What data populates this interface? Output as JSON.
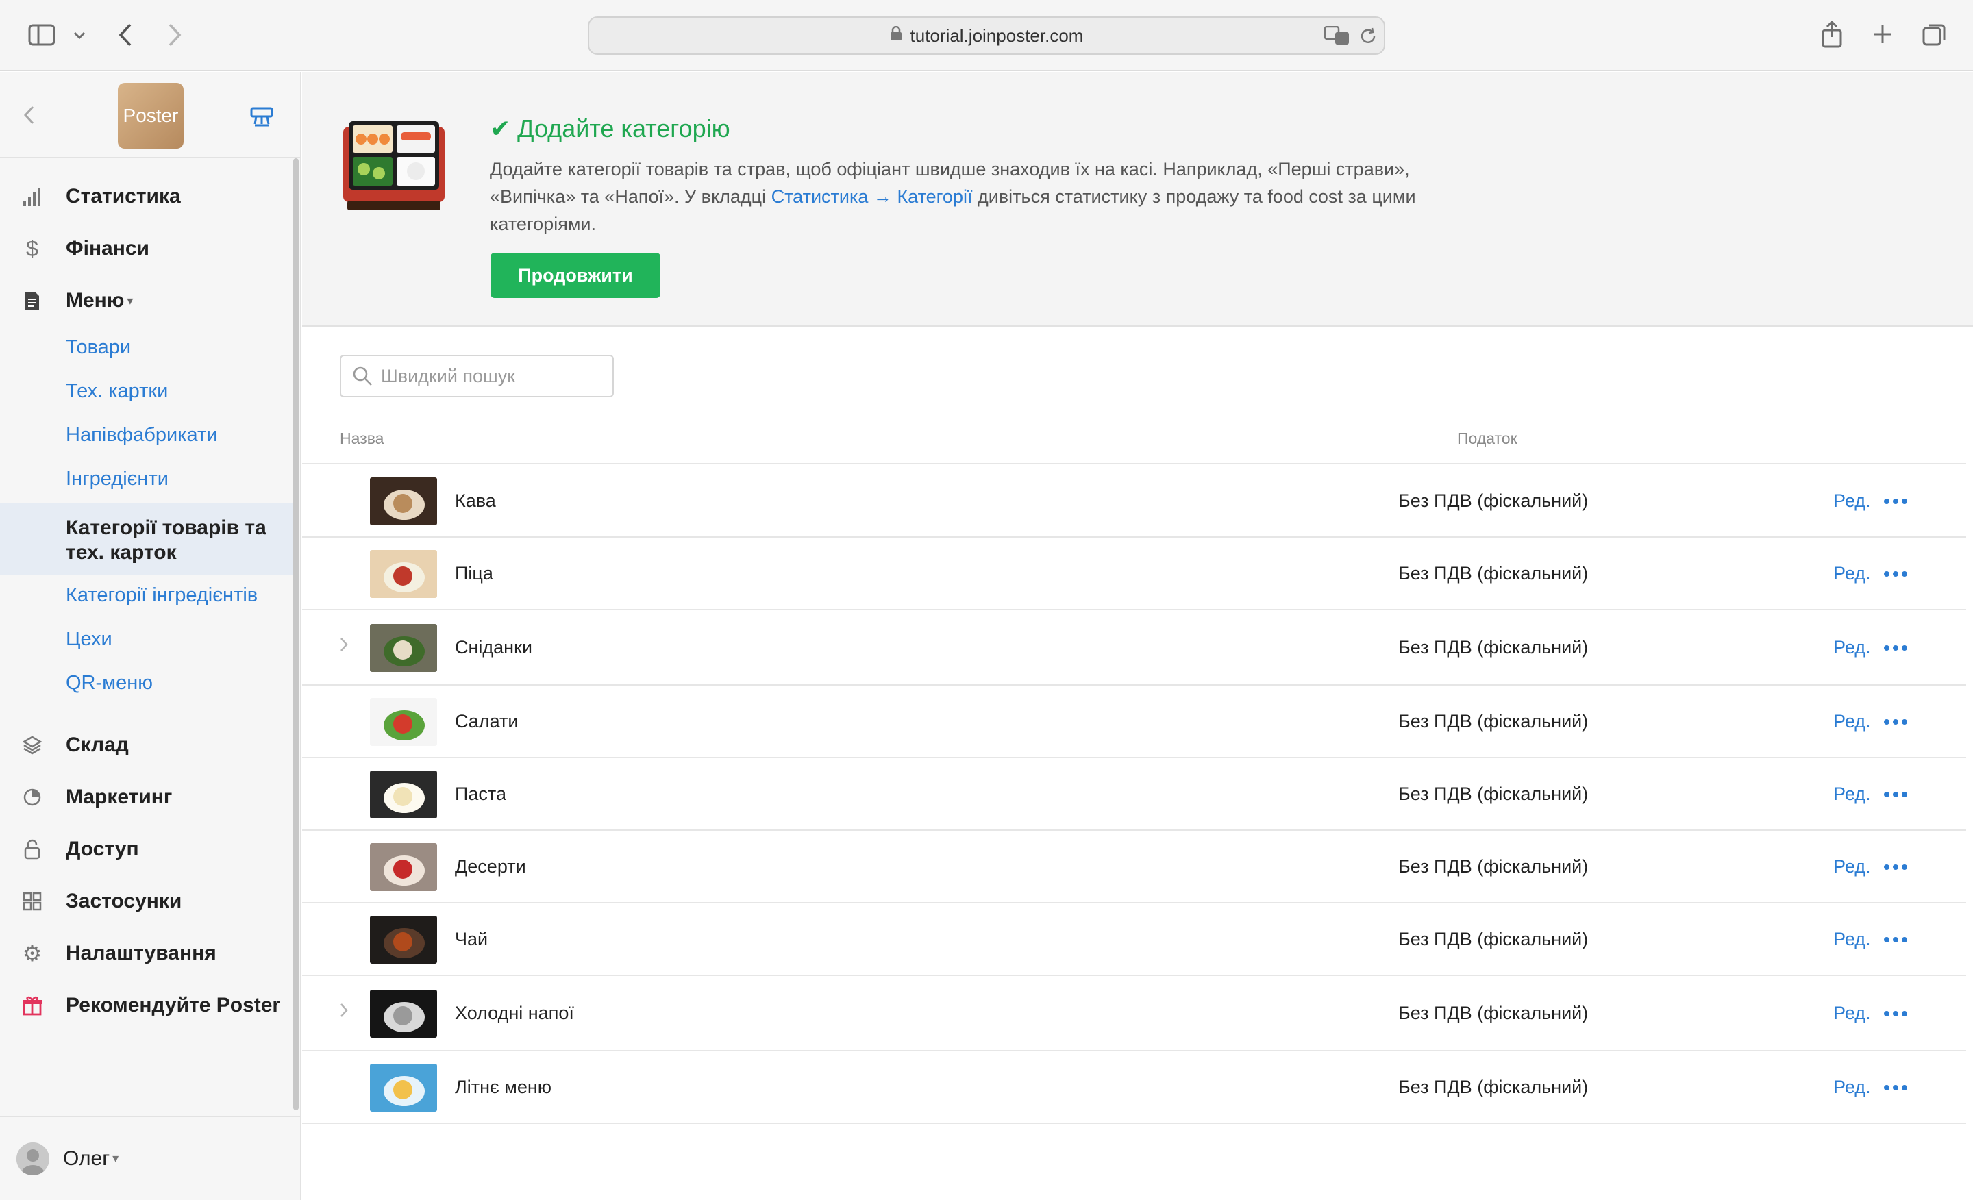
{
  "browser": {
    "url": "tutorial.joinposter.com"
  },
  "sidebar": {
    "logo_text": "Poster",
    "nav": [
      {
        "label": "Статистика",
        "icon": "bar-chart-icon"
      },
      {
        "label": "Фінанси",
        "icon": "dollar-icon"
      },
      {
        "label": "Меню",
        "icon": "document-icon",
        "expanded": true
      }
    ],
    "menu_caret": "▾",
    "sub_items": [
      {
        "label": "Товари"
      },
      {
        "label": "Тех. картки"
      },
      {
        "label": "Напівфабрикати"
      },
      {
        "label": "Інгредієнти"
      }
    ],
    "active_sub": "Категорії товарів та тех. карток",
    "sub_items_after": [
      {
        "label": "Категорії інгредієнтів"
      },
      {
        "label": "Цехи"
      },
      {
        "label": "QR-меню"
      }
    ],
    "nav_bottom": [
      {
        "label": "Склад",
        "icon": "layers-icon"
      },
      {
        "label": "Маркетинг",
        "icon": "pie-icon"
      },
      {
        "label": "Доступ",
        "icon": "lock-icon"
      },
      {
        "label": "Застосунки",
        "icon": "apps-grid-icon"
      },
      {
        "label": "Налаштування",
        "icon": "gear-icon"
      },
      {
        "label": "Рекомендуйте Poster",
        "icon": "gift-icon"
      }
    ],
    "user": "Олег",
    "user_caret": "▾"
  },
  "banner": {
    "title": "✔ Додайте категорію",
    "text_part1": "Додайте категорії товарів та страв, щоб офіціант швидше знаходив їх на касі. Наприклад, «Перші страви», «Випічка» та «Напої». У вкладці ",
    "link1": "Статистика",
    "arrow": " → ",
    "link2": "Категорії",
    "text_part2": " дивіться статистику з продажу та food cost за цими категоріями.",
    "button": "Продовжити"
  },
  "search": {
    "placeholder": "Швидкий пошук"
  },
  "table": {
    "columns": {
      "name": "Назва",
      "tax": "Податок"
    },
    "edit_label": "Ред.",
    "rows": [
      {
        "name": "Кава",
        "tax": "Без ПДВ (фіскальний)",
        "expandable": false
      },
      {
        "name": "Піца",
        "tax": "Без ПДВ (фіскальний)",
        "expandable": false
      },
      {
        "name": "Сніданки",
        "tax": "Без ПДВ (фіскальний)",
        "expandable": true
      },
      {
        "name": "Салати",
        "tax": "Без ПДВ (фіскальний)",
        "expandable": false
      },
      {
        "name": "Паста",
        "tax": "Без ПДВ (фіскальний)",
        "expandable": false
      },
      {
        "name": "Десерти",
        "tax": "Без ПДВ (фіскальний)",
        "expandable": false
      },
      {
        "name": "Чай",
        "tax": "Без ПДВ (фіскальний)",
        "expandable": false
      },
      {
        "name": "Холодні напої",
        "tax": "Без ПДВ (фіскальний)",
        "expandable": true
      },
      {
        "name": "Літнє меню",
        "tax": "Без ПДВ (фіскальний)",
        "expandable": false
      }
    ]
  },
  "colors": {
    "accent_blue": "#2b7cd3",
    "success_green": "#21b45a",
    "title_green": "#1fa750"
  }
}
